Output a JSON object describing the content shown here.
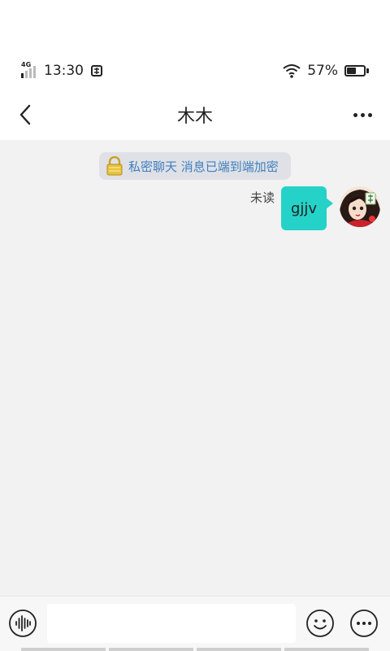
{
  "status_bar": {
    "network": "4G",
    "time": "13:30",
    "battery_percent": "57%",
    "battery_level": 0.57
  },
  "nav": {
    "title": "木木",
    "back_icon": "chevron-left-icon",
    "more_icon": "more-horizontal-icon"
  },
  "chat": {
    "encryption_notice": "私密聊天 消息已端到端加密",
    "messages": [
      {
        "sender": "self",
        "text": "gjjv",
        "status": "未读"
      }
    ]
  },
  "input_bar": {
    "value": "",
    "placeholder": "",
    "voice_icon": "voice-wave-icon",
    "emoji_icon": "emoji-icon",
    "more_icon": "more-options-icon"
  },
  "colors": {
    "bubble": "#24d2c8",
    "encryption_text": "#3f7fbf",
    "background": "#f2f2f2"
  }
}
